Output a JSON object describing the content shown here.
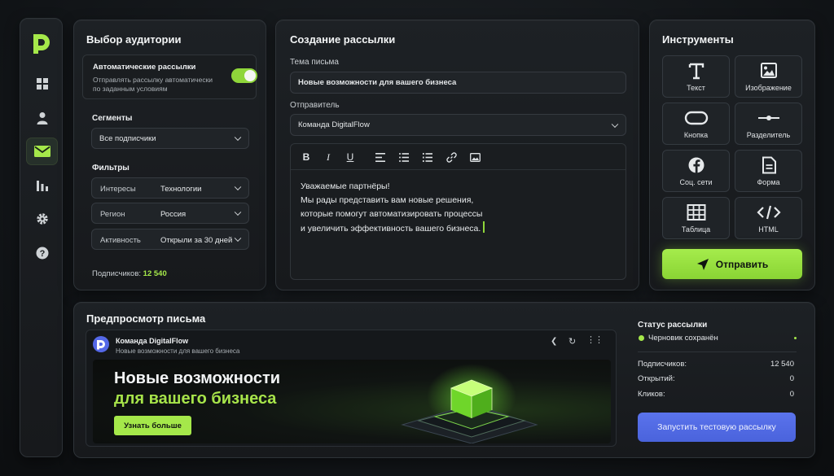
{
  "colors": {
    "accent": "#a5e84a",
    "primary_blue": "#4f68e4",
    "bg": "#111417"
  },
  "sidebar": {
    "logo_icon": "logo-d-icon",
    "items": [
      {
        "icon": "dashboard-icon",
        "active": false
      },
      {
        "icon": "user-icon",
        "active": false
      },
      {
        "icon": "mail-icon",
        "active": true
      },
      {
        "icon": "chart-icon",
        "active": false
      },
      {
        "icon": "gear-icon",
        "active": false
      },
      {
        "icon": "help-icon",
        "active": false
      }
    ]
  },
  "audience": {
    "title": "Выбор аудитории",
    "auto": {
      "title": "Автоматические рассылки",
      "desc_line1": "Отправлять рассылку автоматически",
      "desc_line2": "по заданным условиям",
      "enabled": true
    },
    "segments_label": "Сегменты",
    "segment_value": "Все подписчики",
    "filters_label": "Фильтры",
    "filters": [
      {
        "key": "Интересы",
        "value": "Технологии"
      },
      {
        "key": "Регион",
        "value": "Россия"
      },
      {
        "key": "Активность",
        "value": "Открыли за 30 дней"
      }
    ],
    "subscribers_label": "Подписчиков:",
    "subscribers_value": "12 540"
  },
  "compose": {
    "title": "Создание рассылки",
    "subject_label": "Тема письма",
    "subject_value": "Новые возможности для вашего бизнеса",
    "sender_label": "Отправитель",
    "sender_value": "Команда DigitalFlow",
    "toolbar": [
      "bold-icon",
      "italic-icon",
      "underline-icon",
      "align-left-icon",
      "list-bullet-icon",
      "list-number-icon",
      "link-icon",
      "image-icon"
    ],
    "body": {
      "line1": "Уважаемые партнёры!",
      "line2": "Мы рады представить вам новые решения,",
      "line3": "которые помогут автоматизировать процессы",
      "line4": "и увеличить эффективность вашего бизнеса."
    }
  },
  "tools": {
    "title": "Инструменты",
    "items": [
      {
        "label": "Текст",
        "icon": "text-icon"
      },
      {
        "label": "Изображение",
        "icon": "image-icon"
      },
      {
        "label": "Кнопка",
        "icon": "button-icon"
      },
      {
        "label": "Разделитель",
        "icon": "divider-icon"
      },
      {
        "label": "Соц. сети",
        "icon": "facebook-icon"
      },
      {
        "label": "Форма",
        "icon": "form-icon"
      },
      {
        "label": "Таблица",
        "icon": "table-icon"
      },
      {
        "label": "HTML",
        "icon": "code-icon"
      }
    ],
    "send_label": "Отправить"
  },
  "preview": {
    "title": "Предпросмотр письма",
    "sender": "Команда DigitalFlow",
    "subject": "Новые возможности для вашего бизнеса",
    "banner_line1": "Новые возможности",
    "banner_line2": "для вашего бизнеса",
    "cta_label": "Узнать больше"
  },
  "status": {
    "title": "Статус рассылки",
    "state": "Черновик сохранён",
    "stats": [
      {
        "key": "Подписчиков:",
        "value": "12 540"
      },
      {
        "key": "Открытий:",
        "value": "0"
      },
      {
        "key": "Кликов:",
        "value": "0"
      }
    ],
    "test_button": "Запустить тестовую рассылку"
  }
}
